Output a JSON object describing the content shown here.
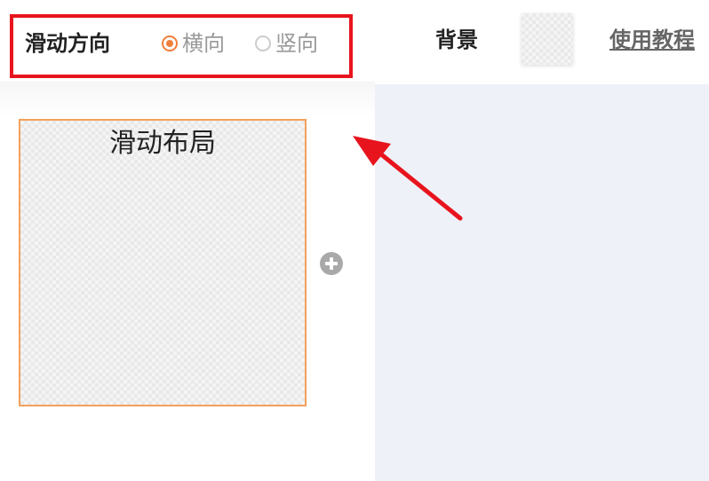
{
  "toolbar": {
    "direction_label": "滑动方向",
    "options": [
      {
        "label": "横向",
        "checked": true
      },
      {
        "label": "竖向",
        "checked": false
      }
    ],
    "background_label": "背景",
    "tutorial_link": "使用教程"
  },
  "panel": {
    "slide_box_title": "滑动布局"
  },
  "colors": {
    "highlight_border": "#e8141d",
    "accent": "#f07f3a",
    "canvas_bg": "#eef1f8",
    "arrow": "#e8141d"
  },
  "icons": {
    "add": "plus-circle-icon",
    "annotation": "red-arrow"
  }
}
